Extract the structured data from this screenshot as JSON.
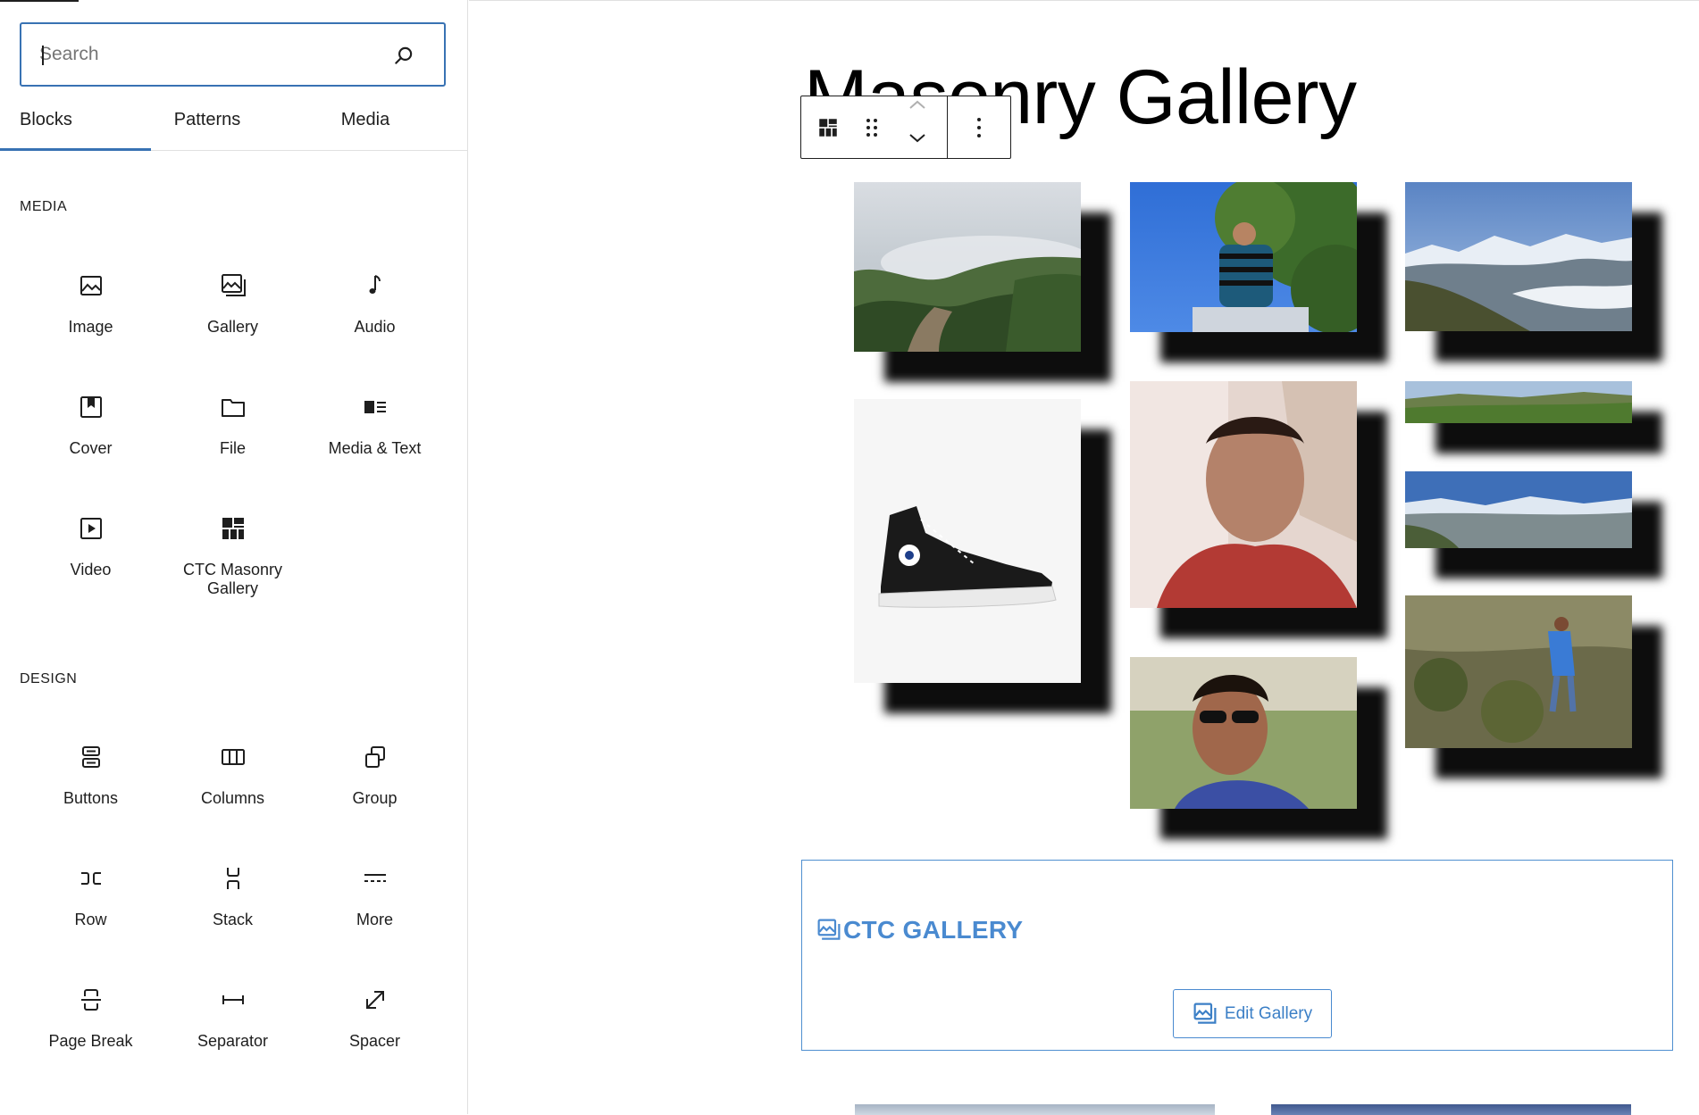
{
  "search": {
    "placeholder": "Search",
    "value": ""
  },
  "tabs": [
    {
      "label": "Blocks",
      "active": true
    },
    {
      "label": "Patterns",
      "active": false
    },
    {
      "label": "Media",
      "active": false
    }
  ],
  "sections": {
    "media": {
      "title": "MEDIA",
      "items": [
        {
          "label": "Image",
          "icon": "image-icon"
        },
        {
          "label": "Gallery",
          "icon": "gallery-icon"
        },
        {
          "label": "Audio",
          "icon": "audio-icon"
        },
        {
          "label": "Cover",
          "icon": "cover-icon"
        },
        {
          "label": "File",
          "icon": "file-icon"
        },
        {
          "label": "Media & Text",
          "icon": "media-text-icon"
        },
        {
          "label": "Video",
          "icon": "video-icon"
        },
        {
          "label": "CTC Masonry Gallery",
          "icon": "masonry-gallery-icon"
        }
      ]
    },
    "design": {
      "title": "DESIGN",
      "items": [
        {
          "label": "Buttons",
          "icon": "buttons-icon"
        },
        {
          "label": "Columns",
          "icon": "columns-icon"
        },
        {
          "label": "Group",
          "icon": "group-icon"
        },
        {
          "label": "Row",
          "icon": "row-icon"
        },
        {
          "label": "Stack",
          "icon": "stack-icon"
        },
        {
          "label": "More",
          "icon": "more-icon"
        },
        {
          "label": "Page Break",
          "icon": "page-break-icon"
        },
        {
          "label": "Separator",
          "icon": "separator-icon"
        },
        {
          "label": "Spacer",
          "icon": "spacer-icon"
        }
      ]
    }
  },
  "canvas": {
    "title": "Masonry Gallery",
    "gallery": {
      "photos": [
        {
          "name": "misty-valley-photo"
        },
        {
          "name": "man-in-tree-photo"
        },
        {
          "name": "mountain-range-photo"
        },
        {
          "name": "sneaker-photo"
        },
        {
          "name": "selfie-photo"
        },
        {
          "name": "green-plateau-photo"
        },
        {
          "name": "valley-panorama-photo"
        },
        {
          "name": "sunglasses-portrait-photo"
        },
        {
          "name": "hillside-hiker-photo"
        }
      ]
    },
    "ctc_block": {
      "title": "CTC GALLERY",
      "edit_button": "Edit Gallery"
    }
  },
  "colors": {
    "accent": "#3872b3",
    "ctc_blue": "#4a8ad0"
  }
}
